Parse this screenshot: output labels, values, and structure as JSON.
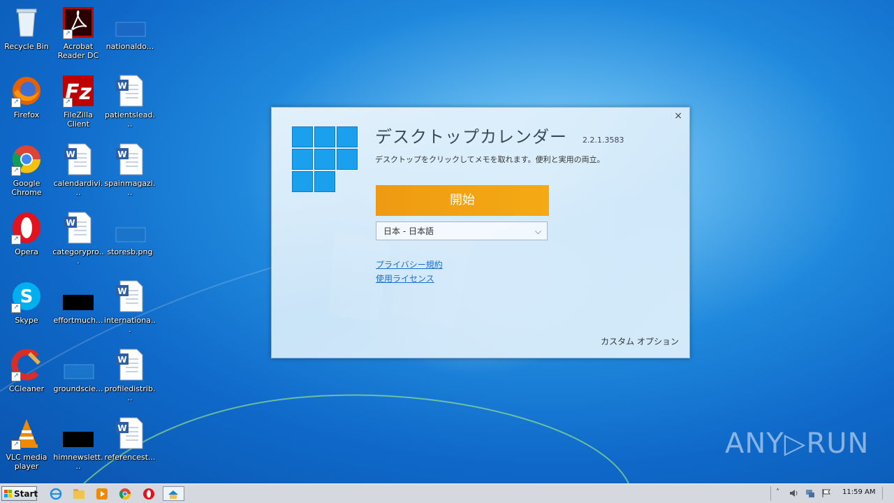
{
  "desktop": {
    "icons": [
      {
        "label": "Recycle Bin"
      },
      {
        "label": "Acrobat Reader DC"
      },
      {
        "label": "nationaldo..."
      },
      {
        "label": "Firefox"
      },
      {
        "label": "FileZilla Client"
      },
      {
        "label": "patientslead..."
      },
      {
        "label": "Google Chrome"
      },
      {
        "label": "calendardivi..."
      },
      {
        "label": "spainmagazi..."
      },
      {
        "label": "Opera"
      },
      {
        "label": "categorypro..."
      },
      {
        "label": "storesb.png"
      },
      {
        "label": "Skype"
      },
      {
        "label": "effortmuch..."
      },
      {
        "label": "internationa..."
      },
      {
        "label": "CCleaner"
      },
      {
        "label": "groundscie..."
      },
      {
        "label": "profiledistrib..."
      },
      {
        "label": "VLC media player"
      },
      {
        "label": "himnewslett..."
      },
      {
        "label": "referencest..."
      }
    ]
  },
  "dialog": {
    "title": "デスクトップカレンダー",
    "version": "2.2.1.3583",
    "subtitle": "デスクトップをクリックしてメモを取れます。便利と実用の両立。",
    "start_label": "開始",
    "language": "日本 - 日本語",
    "privacy_link": "プライバシー規約",
    "license_link": "使用ライセンス",
    "custom_options": "カスタム オプション",
    "close_icon": "×"
  },
  "taskbar": {
    "start_label": "Start",
    "clock": "11:59 AM"
  },
  "watermark": "ANY▷RUN",
  "colors": {
    "start_button": "#f29c12",
    "link": "#1e6fc9",
    "tile": "#1aa0ec"
  }
}
